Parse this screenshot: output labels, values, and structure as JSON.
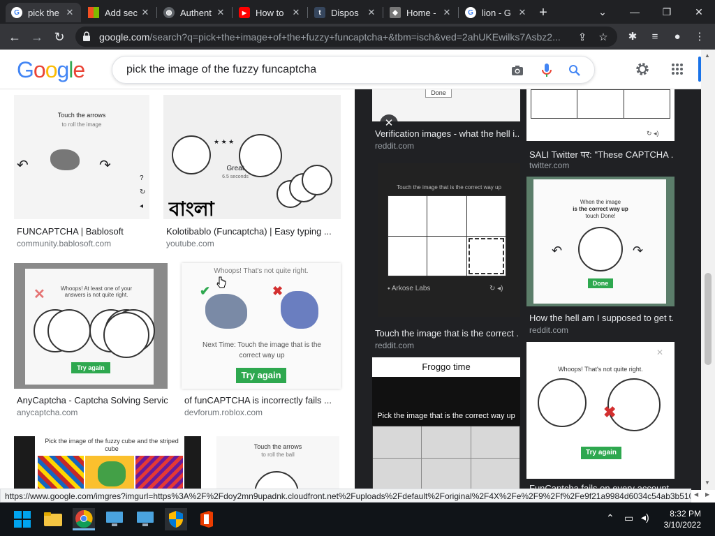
{
  "tabs": [
    {
      "label": "pick the",
      "icon": "google-icon",
      "active": true
    },
    {
      "label": "Add sec",
      "icon": "microsoft-icon"
    },
    {
      "label": "Authent",
      "icon": "globe-icon"
    },
    {
      "label": "How to",
      "icon": "youtube-icon"
    },
    {
      "label": "Dispos",
      "icon": "tumblr-icon"
    },
    {
      "label": "Home -",
      "icon": "cube-icon"
    },
    {
      "label": "lion - G",
      "icon": "google-icon"
    }
  ],
  "address_bar": {
    "domain": "google.com",
    "path": "/search?q=pick+the+image+of+the+fuzzy+funcaptcha+&tbm=isch&ved=2ahUKEwilks7Asbz2..."
  },
  "search": {
    "query": "pick the image of the fuzzy funcaptcha"
  },
  "logo": {
    "text": "Google"
  },
  "left_results": [
    {
      "title": "FUNCAPTCHA | Bablosoft",
      "source": "community.bablosoft.com",
      "caption1": "Touch the arrows",
      "caption2": "to roll the image"
    },
    {
      "title": "Kolotibablo (Funcaptcha) | Easy typing ...",
      "source": "youtube.com",
      "overlay": "বাংলা",
      "great": "Great",
      "seconds": "6.5 seconds"
    },
    {
      "title": "AnyCaptcha - Captcha Solving Service",
      "source": "anycaptcha.com",
      "caption1": "Whoops! At least one of your answers is not quite right.",
      "button": "Try again"
    },
    {
      "title": "of funCAPTCHA is incorrectly fails ...",
      "source": "devforum.roblox.com",
      "caption1": "Whoops! That's not quite right.",
      "caption2": "Next Time: Touch the image that is the correct way up",
      "button": "Try again"
    },
    {
      "caption1": "Pick the image of the fuzzy cube and the striped cube"
    },
    {
      "caption1": "Touch the arrows",
      "caption2": "to roll the ball"
    }
  ],
  "right_results": [
    {
      "title": "Verification images - what the hell i...",
      "source": "reddit.com",
      "caption1": "Done"
    },
    {
      "title": "SALI Twitter पर: \"These CAPTCHA ...",
      "source": "twitter.com"
    },
    {
      "title": "Touch the image that is the correct ...",
      "source": "reddit.com",
      "caption1": "Touch the image that is the correct way up",
      "brand": "Arkose Labs"
    },
    {
      "title": "How the hell am I supposed to get t...",
      "source": "reddit.com",
      "caption1": "When the image",
      "caption2": "is the correct way up",
      "caption3": "touch Done!",
      "button": "Done"
    },
    {
      "caption1": "Froggo time",
      "caption2": "Pick the image that is the correct way up"
    },
    {
      "title": "FunCaptcha fails on every account",
      "caption1": "Whoops! That's not quite right.",
      "button": "Try again"
    }
  ],
  "status_link": "https://www.google.com/imgres?imgurl=https%3A%2F%2Fdoy2mn9upadnk.cloudfront.net%2Fuploads%2Fdefault%2Foriginal%2F4X%2Fe%2F9%2Ff%2Fe9f21a9984d6034c54ab3b5104...",
  "clock": {
    "time": "8:32 PM",
    "date": "3/10/2022"
  },
  "colors": {
    "accent_green": "#2ea84f",
    "chrome_dark": "#202124",
    "google_blue": "#4285f4"
  }
}
